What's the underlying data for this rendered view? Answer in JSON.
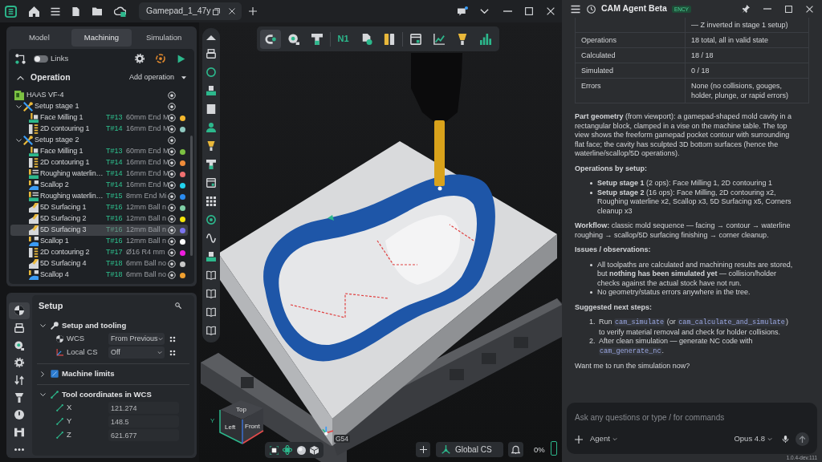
{
  "title_bar": {
    "tab_title": "Gamepad_1_47y"
  },
  "left_panel": {
    "tabs": [
      {
        "label": "Model",
        "selected": false
      },
      {
        "label": "Machining",
        "selected": true
      },
      {
        "label": "Simulation",
        "selected": false
      }
    ],
    "links": {
      "label": "Links",
      "on": false
    },
    "header": {
      "title": "Operation",
      "expanded": true,
      "add_label": "Add operation"
    },
    "tree": [
      {
        "kind": "machine",
        "name": "HAAS VF-4",
        "children": [
          {
            "kind": "setup",
            "name": "Setup stage 1",
            "expanded": true,
            "children": [
              {
                "kind": "face",
                "name": "Face Milling 1",
                "tool": "T#13",
                "tool_desc": "60mm End M",
                "color": "#f5b82e",
                "selected": false
              },
              {
                "kind": "contour",
                "name": "2D contouring 1",
                "tool": "T#14",
                "tool_desc": "16mm End M",
                "color": "#8fc9c0",
                "selected": false
              }
            ]
          },
          {
            "kind": "setup",
            "name": "Setup stage 2",
            "expanded": true,
            "children": [
              {
                "kind": "face",
                "name": "Face Milling 1",
                "tool": "T#13",
                "tool_desc": "60mm End M",
                "color": "#7cc142",
                "selected": false
              },
              {
                "kind": "contour",
                "name": "2D contouring 1",
                "tool": "T#14",
                "tool_desc": "16mm End M",
                "color": "#f08c3a",
                "selected": false
              },
              {
                "kind": "waterline",
                "name": "Roughing waterlin…",
                "tool": "T#14",
                "tool_desc": "16mm End M",
                "color": "#f07070",
                "selected": false
              },
              {
                "kind": "scallop",
                "name": "Scallop 2",
                "tool": "T#14",
                "tool_desc": "16mm End M",
                "color": "#22d3ee",
                "selected": false
              },
              {
                "kind": "waterline",
                "name": "Roughing waterlin…",
                "tool": "T#15",
                "tool_desc": "8mm End Mi",
                "color": "#2b8cf0",
                "selected": false
              },
              {
                "kind": "surfacing",
                "name": "5D Surfacing 1",
                "tool": "T#16",
                "tool_desc": "12mm Ball n",
                "color": "#80d0a8",
                "selected": false
              },
              {
                "kind": "surfacing",
                "name": "5D Surfacing 2",
                "tool": "T#16",
                "tool_desc": "12mm Ball n",
                "color": "#f5e50a",
                "selected": false
              },
              {
                "kind": "surfacing",
                "name": "5D Surfacing 3",
                "tool": "T#16",
                "tool_desc": "12mm Ball n",
                "color": "#7b74f0",
                "selected": true
              },
              {
                "kind": "scallop",
                "name": "Scallop 1",
                "tool": "T#16",
                "tool_desc": "12mm Ball n",
                "color": "#ffffff",
                "selected": false
              },
              {
                "kind": "contour",
                "name": "2D contouring 2",
                "tool": "T#17",
                "tool_desc": "Ø16 R4 mm",
                "color": "#f01ee0",
                "selected": false
              },
              {
                "kind": "surfacing",
                "name": "5D Surfacing 4",
                "tool": "T#18",
                "tool_desc": "6mm Ball no",
                "color": "#c8c8c8",
                "selected": false
              },
              {
                "kind": "scallop",
                "name": "Scallop 4",
                "tool": "T#18",
                "tool_desc": "6mm Ball no",
                "color": "#f0a030",
                "selected": false
              }
            ]
          }
        ]
      }
    ]
  },
  "setup_panel": {
    "side_tabs": [
      {
        "selected": true
      },
      {
        "selected": false
      },
      {
        "selected": false
      },
      {
        "selected": false
      },
      {
        "selected": false
      },
      {
        "selected": false
      },
      {
        "selected": false
      },
      {
        "selected": false
      },
      {
        "selected": false
      }
    ],
    "title": "Setup",
    "sections": [
      {
        "title": "Setup and tooling",
        "expanded": true,
        "rows": [
          {
            "kind": "dropdown",
            "label": "WCS",
            "value": "From Previous"
          },
          {
            "kind": "dropdown",
            "label": "Local CS",
            "value": "Off"
          }
        ]
      },
      {
        "title": "Machine limits",
        "expanded": false
      },
      {
        "title": "Tool coordinates in WCS",
        "expanded": true,
        "rows": [
          {
            "kind": "number",
            "label": "X",
            "value": "121.274"
          },
          {
            "kind": "number",
            "label": "Y",
            "value": "148.5"
          },
          {
            "kind": "number",
            "label": "Z",
            "value": "621.677"
          }
        ]
      }
    ]
  },
  "viewport": {
    "view_toolbar": [
      {
        "kind": "icon",
        "selected": true
      },
      {
        "kind": "icon",
        "selected": false
      },
      {
        "kind": "icon",
        "selected": false
      },
      {
        "kind": "text",
        "label": "N1",
        "selected": false
      },
      {
        "kind": "icon",
        "selected": false
      },
      {
        "kind": "icon",
        "selected": false
      },
      {
        "kind": "icon",
        "selected": false
      },
      {
        "kind": "icon",
        "selected": false
      },
      {
        "kind": "icon",
        "selected": false
      },
      {
        "kind": "icon",
        "selected": false
      }
    ],
    "view_cube": {
      "top_label": "Top",
      "left_label": "Left",
      "front_label": "Front"
    },
    "axis_label": "Y",
    "wcs_label": "G54",
    "coord_system": "Global CS",
    "progress": {
      "label": "0%",
      "level": 0
    }
  },
  "agent_panel": {
    "title": "CAM Agent Beta",
    "badge": "ENCY",
    "summary_table": {
      "rows": [
        {
          "value": "— Z inverted in stage 1 setup)"
        },
        {
          "label": "Operations",
          "value": "18 total, all in valid state"
        },
        {
          "label": "Calculated",
          "value": "18 / 18"
        },
        {
          "label": "Simulated",
          "value": "0 / 18"
        },
        {
          "label": "Errors",
          "value": "None (no collisions, gouges, holder, plunge, or rapid errors)"
        }
      ]
    },
    "message": [
      {
        "kind": "paragraph",
        "text": "**Part geometry** (from viewport): a gamepad-shaped mold cavity in a rectangular block, clamped in a vise on the machine table. The top view shows the freeform gamepad pocket contour with surrounding flat face; the cavity has sculpted 3D bottom surfaces (hence the waterline/scallop/5D operations)."
      },
      {
        "kind": "heading",
        "text": "Operations by setup:"
      },
      {
        "kind": "bullets",
        "items": [
          "**Setup stage 1** (2 ops): Face Milling 1, 2D contouring 1",
          "**Setup stage 2** (16 ops): Face Milling, 2D contouring x2, Roughing waterline x2, Scallop x3, 5D Surfacing x5, Corners cleanup x3"
        ]
      },
      {
        "kind": "paragraph",
        "text": "**Workflow:** classic mold sequence — facing → contour → waterline roughing → scallop/5D surfacing finishing → corner cleanup."
      },
      {
        "kind": "heading",
        "text": "Issues / observations:"
      },
      {
        "kind": "bullets",
        "items": [
          "All toolpaths are calculated and machining results are stored, but **nothing has been simulated yet** — collision/holder checks against the actual stock have not run.",
          "No geometry/status errors anywhere in the tree."
        ]
      },
      {
        "kind": "heading",
        "text": "Suggested next steps:"
      },
      {
        "kind": "numbered",
        "items": [
          {
            "number": "1.",
            "segments": [
              {
                "kind": "text",
                "text": "Run "
              },
              {
                "kind": "code",
                "text": "cam_simulate"
              },
              {
                "kind": "text",
                "text": " (or "
              },
              {
                "kind": "code",
                "text": "cam_calculate_and_simulate"
              },
              {
                "kind": "text",
                "text": ") to verify material removal and check for holder collisions."
              }
            ]
          },
          {
            "number": "2.",
            "segments": [
              {
                "kind": "text",
                "text": "After clean simulation — generate NC code with "
              },
              {
                "kind": "code",
                "text": "cam_generate_nc"
              },
              {
                "kind": "text",
                "text": "."
              }
            ]
          }
        ]
      },
      {
        "kind": "paragraph",
        "text": "Want me to run the simulation now?"
      }
    ],
    "composer": {
      "placeholder": "Ask any questions or type / for commands",
      "mode": "Agent",
      "model": "Opus 4.8"
    },
    "version": "1.0.4-dev.111"
  }
}
